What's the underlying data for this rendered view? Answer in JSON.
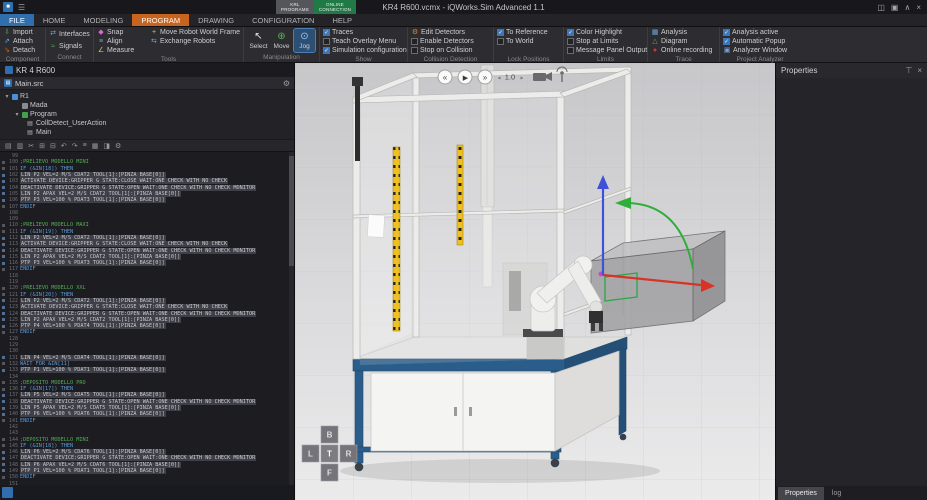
{
  "colors": {
    "accent_orange": "#c8641f",
    "accent_blue": "#2f6fad",
    "accent_green": "#1f7a45",
    "checkbox_blue": "#3c76bb"
  },
  "icons": {
    "app": "■",
    "hamburger": "☰",
    "panels": "◫",
    "panel_alt": "▣",
    "chevron_up": "∧",
    "close": "×",
    "pin": "⊤",
    "gear": "⚙",
    "doc": "▤",
    "caret_down": "▾",
    "import": "⇩",
    "attach": "⇗",
    "detach": "⇘",
    "interfaces": "⇄",
    "signals": "≈",
    "snap": "◆",
    "align": "≡",
    "measure": "∠",
    "move_robot_frame": "+",
    "exchange_robots": "⇆",
    "select": "↖",
    "move": "⊕",
    "jog": "⊙",
    "edit_detectors": "⚙",
    "analysis": "▦",
    "diagram": "△",
    "online_recording": "●",
    "analyzer_window": "▣",
    "check": "✓",
    "editor_tools": [
      "▤",
      "▥",
      "✂",
      "⊞",
      "⊟",
      "↶",
      "↷",
      "≡",
      "▦",
      "◨",
      "⚙"
    ],
    "editor_tool_names": [
      "new-file-icon",
      "save-icon",
      "cut-icon",
      "copy-icon",
      "paste-icon",
      "undo-icon",
      "redo-icon",
      "align-icon",
      "grid-icon",
      "split-view-icon",
      "settings-icon"
    ]
  },
  "title_bar": {
    "title": "KR4 R600.vcmx - iQWorks.Sim Advanced 1.1",
    "context_tabs": {
      "krl_line1": "KRL",
      "krl_line2": "PROGRAMS",
      "online_line1": "ONLINE",
      "online_line2": "CONNECTION"
    }
  },
  "ribbon": {
    "tabs": [
      "FILE",
      "HOME",
      "MODELING",
      "PROGRAM",
      "DRAWING",
      "CONFIGURATION",
      "HELP"
    ],
    "active_tab": "PROGRAM",
    "groups": {
      "component": {
        "label": "Component",
        "import": "Import",
        "attach": "Attach",
        "detach": "Detach"
      },
      "connect": {
        "label": "Connect",
        "interfaces": "Interfaces",
        "signals": "Signals"
      },
      "tools": {
        "label": "Tools",
        "snap": "Snap",
        "align": "Align",
        "measure": "Measure",
        "move_frame": "Move Robot World Frame",
        "exchange": "Exchange Robots"
      },
      "manipulation": {
        "label": "Manipulation",
        "select": "Select",
        "move": "Move",
        "jog": "Jog"
      },
      "show": {
        "label": "Show",
        "traces": "Traces",
        "teach": "Teach Overlay Menu",
        "simconf": "Simulation configuration",
        "traces_checked": true,
        "teach_checked": false,
        "simconf_checked": true
      },
      "collision": {
        "label": "Collision Detection",
        "edit": "Edit Detectors",
        "enable": "Enable Detectors",
        "stop": "Stop on Collision",
        "enable_checked": false,
        "stop_checked": false
      },
      "lock": {
        "label": "Lock Positions",
        "to_reference": "To Reference",
        "to_world": "To World",
        "to_reference_checked": true,
        "to_world_checked": false
      },
      "limits": {
        "label": "Limits",
        "color": "Color Highlight",
        "stop": "Stop at Limits",
        "message": "Message Panel Output",
        "color_checked": true,
        "stop_checked": false,
        "message_checked": false
      },
      "trace": {
        "label": "Trace",
        "analysis": "Analysis",
        "diagram": "Diagram",
        "online": "Online recording"
      },
      "analyzer": {
        "label": "Project Analyzer",
        "active": "Analysis active",
        "popup": "Automatic Popup",
        "window": "Analyzer Window",
        "active_checked": true,
        "popup_checked": true
      }
    }
  },
  "left_panel": {
    "title": "KR 4 R600",
    "file_row": {
      "label": "Main.src"
    },
    "tree": {
      "items": [
        {
          "label": "R1"
        },
        {
          "label": "Mada"
        },
        {
          "label": "Program"
        },
        {
          "label": "CollDetect_UserAction"
        },
        {
          "label": "Main"
        }
      ]
    }
  },
  "editor": {
    "lines": [
      {
        "n": 99,
        "y": "b",
        "t": ""
      },
      {
        "n": 100,
        "y": "c",
        "t": ";PRELIEVO MODELLO MINI"
      },
      {
        "n": 101,
        "y": "k",
        "t": "IF (&IN[18]) THEN"
      },
      {
        "n": 102,
        "y": "s",
        "t": "LIN P2 VEL=2 M/S CDAT2 TOOL[1]:[PINZA BASE[0]]"
      },
      {
        "n": 103,
        "y": "s",
        "t": "ACTIVATE DEVICE:GRIPPER G STATE:CLOSE WAIT:ONE CHECK WITH NO CHECK"
      },
      {
        "n": 104,
        "y": "s",
        "t": "DEACTIVATE DEVICE:GRIPPER G STATE:OPEN WAIT:ONE CHECK WITH NO CHECK MONITOR"
      },
      {
        "n": 105,
        "y": "s",
        "t": "LIN P2 APAX VEL=2 M/S CDAT2 TOOL[1]:[PINZA BASE[0]]"
      },
      {
        "n": 106,
        "y": "s",
        "t": "PTP P3 VEL=100 % PDAT3 TOOL[1]:[PINZA BASE[0]]"
      },
      {
        "n": 107,
        "y": "k",
        "t": "ENDIF"
      },
      {
        "n": 108,
        "y": "b",
        "t": ""
      },
      {
        "n": 109,
        "y": "b",
        "t": ""
      },
      {
        "n": 110,
        "y": "c",
        "t": ";PRELIEVO MODELLO MAXI"
      },
      {
        "n": 111,
        "y": "k",
        "t": "IF (&IN[19]) THEN"
      },
      {
        "n": 112,
        "y": "s",
        "t": "LIN P2 VEL=2 M/S CDAT2 TOOL[1]:[PINZA BASE[0]]"
      },
      {
        "n": 113,
        "y": "s",
        "t": "ACTIVATE DEVICE:GRIPPER G STATE:CLOSE WAIT:ONE CHECK WITH NO CHECK"
      },
      {
        "n": 114,
        "y": "s",
        "t": "DEACTIVATE DEVICE:GRIPPER G STATE:OPEN WAIT:ONE CHECK WITH NO CHECK MONITOR"
      },
      {
        "n": 115,
        "y": "s",
        "t": "LIN P2 APAX VEL=2 M/S CDAT2 TOOL[1]:[PINZA BASE[0]]"
      },
      {
        "n": 116,
        "y": "s",
        "t": "PTP P3 VEL=100 % PDAT3 TOOL[1]:[PINZA BASE[0]]"
      },
      {
        "n": 117,
        "y": "k",
        "t": "ENDIF"
      },
      {
        "n": 118,
        "y": "b",
        "t": ""
      },
      {
        "n": 119,
        "y": "b",
        "t": ""
      },
      {
        "n": 120,
        "y": "c",
        "t": ";PRELIEVO MODELLO XXL"
      },
      {
        "n": 121,
        "y": "k",
        "t": "IF (&IN[20]) THEN"
      },
      {
        "n": 122,
        "y": "s",
        "t": "LIN P2 VEL=2 M/S CDAT2 TOOL[1]:[PINZA BASE[0]]"
      },
      {
        "n": 123,
        "y": "s",
        "t": "ACTIVATE DEVICE:GRIPPER G STATE:CLOSE WAIT:ONE CHECK WITH NO CHECK"
      },
      {
        "n": 124,
        "y": "s",
        "t": "DEACTIVATE DEVICE:GRIPPER G STATE:OPEN WAIT:ONE CHECK WITH NO CHECK MONITOR"
      },
      {
        "n": 125,
        "y": "s",
        "t": "LIN P2 APAX VEL=2 M/S CDAT2 TOOL[1]:[PINZA BASE[0]]"
      },
      {
        "n": 126,
        "y": "s",
        "t": "PTP P4 VEL=100 % PDAT4 TOOL[1]:[PINZA BASE[0]]"
      },
      {
        "n": 127,
        "y": "k",
        "t": "ENDIF"
      },
      {
        "n": 128,
        "y": "b",
        "t": ""
      },
      {
        "n": 129,
        "y": "b",
        "t": ""
      },
      {
        "n": 130,
        "y": "b",
        "t": ""
      },
      {
        "n": 131,
        "y": "s",
        "t": "LIN P4 VEL=2 M/S CDAT4 TOOL[1]:[PINZA BASE[0]]"
      },
      {
        "n": 132,
        "y": "k",
        "t": "WAIT FOR &IN[11]"
      },
      {
        "n": 133,
        "y": "s",
        "t": "PTP P1 VEL=100 % PDAT1 TOOL[1]:[PINZA BASE[0]]"
      },
      {
        "n": 134,
        "y": "b",
        "t": ""
      },
      {
        "n": 135,
        "y": "c",
        "t": ";DEPOSITO MODELLO PRO"
      },
      {
        "n": 136,
        "y": "k",
        "t": "IF (&IN[17]) THEN"
      },
      {
        "n": 137,
        "y": "s",
        "t": "LIN P5 VEL=2 M/S CDAT5 TOOL[1]:[PINZA BASE[0]]"
      },
      {
        "n": 138,
        "y": "s",
        "t": "DEACTIVATE DEVICE:GRIPPER G STATE:OPEN WAIT:ONE CHECK WITH NO CHECK MONITOR"
      },
      {
        "n": 139,
        "y": "s",
        "t": "LIN P5 APAX VEL=2 M/S CDAT5 TOOL[1]:[PINZA BASE[0]]"
      },
      {
        "n": 140,
        "y": "s",
        "t": "PTP P6 VEL=100 % PDAT6 TOOL[1]:[PINZA BASE[0]]"
      },
      {
        "n": 141,
        "y": "k",
        "t": "ENDIF"
      },
      {
        "n": 142,
        "y": "b",
        "t": ""
      },
      {
        "n": 143,
        "y": "b",
        "t": ""
      },
      {
        "n": 144,
        "y": "c",
        "t": ";DEPOSITO MODELLO MINI"
      },
      {
        "n": 145,
        "y": "k",
        "t": "IF (&IN[18]) THEN"
      },
      {
        "n": 146,
        "y": "s",
        "t": "LIN P6 VEL=2 M/S CDAT6 TOOL[1]:[PINZA BASE[0]]"
      },
      {
        "n": 147,
        "y": "s",
        "t": "DEACTIVATE DEVICE:GRIPPER G STATE:OPEN WAIT:ONE CHECK WITH NO CHECK MONITOR"
      },
      {
        "n": 148,
        "y": "s",
        "t": "LIN P6 APAX VEL=2 M/S CDAT6 TOOL[1]:[PINZA BASE[0]]"
      },
      {
        "n": 149,
        "y": "s",
        "t": "PTP P1 VEL=100 % PDAT1 TOOL[1]:[PINZA BASE[0]]"
      },
      {
        "n": 150,
        "y": "k",
        "t": "ENDIF"
      },
      {
        "n": 151,
        "y": "b",
        "t": ""
      }
    ]
  },
  "viewport": {
    "speed": "1.0",
    "nav_cube": {
      "north": "B",
      "west": "L",
      "center": "T",
      "east": "R",
      "south": "F"
    }
  },
  "right_panel": {
    "title": "Properties",
    "tab_properties": "Properties",
    "tab_log": "log"
  }
}
